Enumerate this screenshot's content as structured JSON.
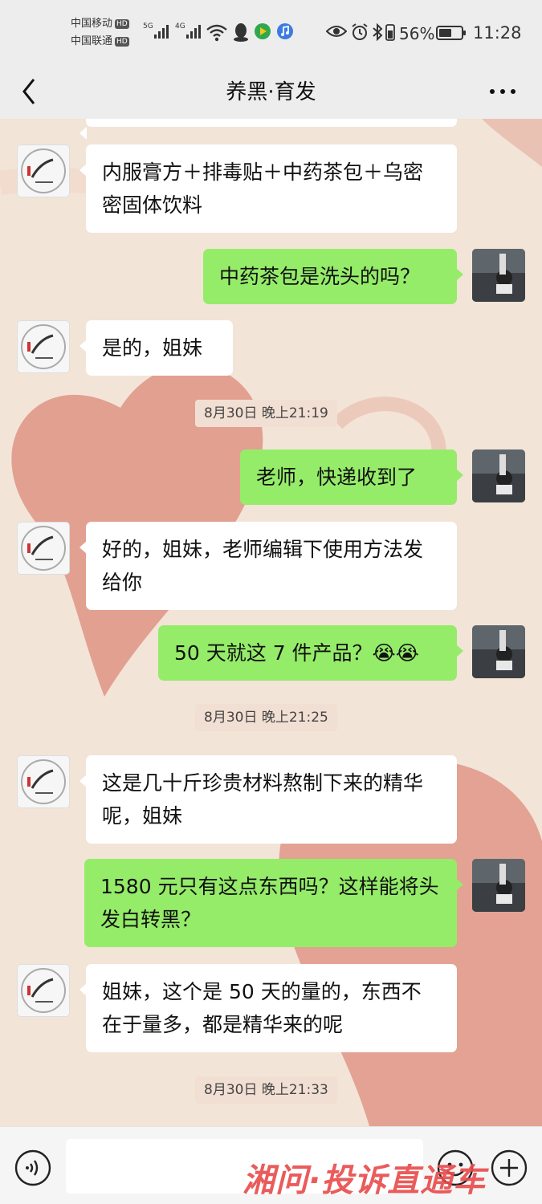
{
  "status_bar": {
    "carrier1": "中国移动",
    "carrier2": "中国联通",
    "hd": "HD",
    "net1": "5G",
    "net2": "4G",
    "battery_percent": "56%",
    "battery_level": 0.56,
    "time": "11:28"
  },
  "header": {
    "title": "养黑·育发"
  },
  "messages": [
    {
      "side": "in",
      "text": "内服膏方＋排毒贴＋中药茶包＋乌密密固体饮料"
    },
    {
      "side": "out",
      "text": "中药茶包是洗头的吗？"
    },
    {
      "side": "in",
      "text": "是的，姐妹"
    },
    {
      "type": "timestamp",
      "text": "8月30日 晚上21:19"
    },
    {
      "side": "out",
      "text": "老师，快递收到了"
    },
    {
      "side": "in",
      "text": "好的，姐妹，老师编辑下使用方法发给你"
    },
    {
      "side": "out",
      "text": "50 天就这 7 件产品？😭😭"
    },
    {
      "type": "timestamp",
      "text": "8月30日 晚上21:25"
    },
    {
      "side": "in",
      "text": "这是几十斤珍贵材料熬制下来的精华呢，姐妹"
    },
    {
      "side": "out",
      "text": "1580 元只有这点东西吗？这样能将头发白转黑？"
    },
    {
      "side": "in",
      "text": "姐妹，这个是 50 天的量的，东西不在于量多，都是精华来的呢"
    },
    {
      "type": "timestamp",
      "text": "8月30日 晚上21:33"
    }
  ],
  "watermark": "湘问·投诉直通车",
  "colors": {
    "outgoing_bubble": "#95ec69",
    "incoming_bubble": "#ffffff",
    "bar_bg": "#ededed"
  },
  "icons": [
    "back-icon",
    "more-icon",
    "voice-icon",
    "emoji-icon",
    "plus-icon"
  ]
}
